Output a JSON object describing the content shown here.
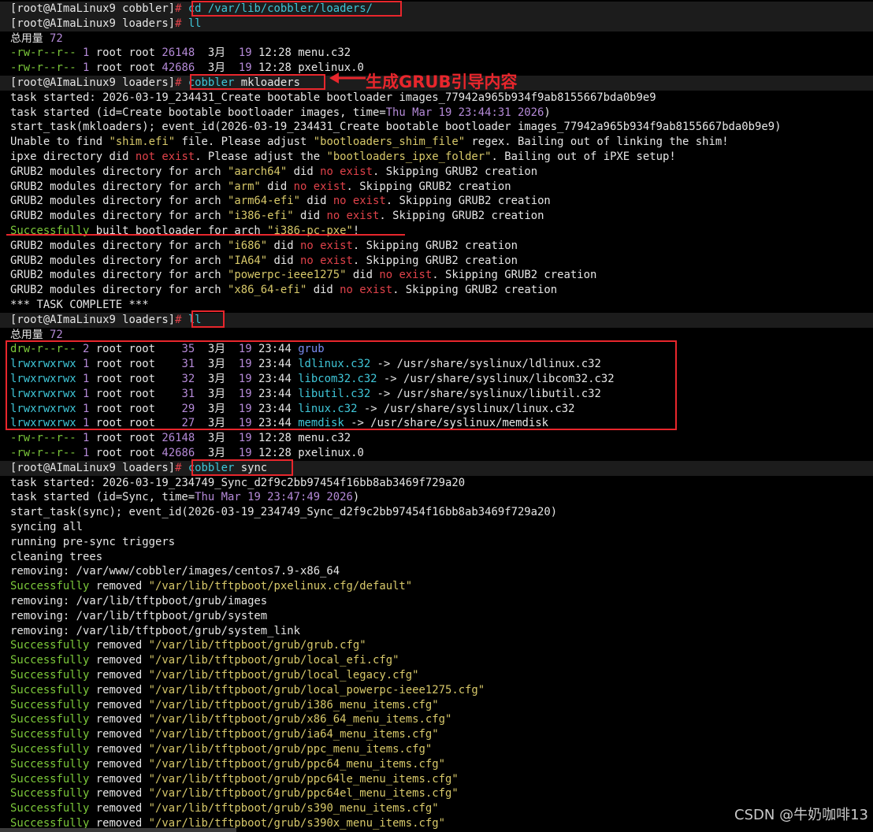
{
  "terminal": {
    "lines": [
      [
        {
          "t": "[root@AImaLinux9 cobbler]",
          "c": "w"
        },
        {
          "t": "# ",
          "c": "r"
        },
        {
          "t": "cd /var/lib/cobbler/loaders/",
          "c": "c"
        }
      ],
      [
        {
          "t": "[root@AImaLinux9 loaders]",
          "c": "w"
        },
        {
          "t": "# ",
          "c": "r"
        },
        {
          "t": "ll",
          "c": "c"
        }
      ],
      [
        {
          "t": "总用量 ",
          "c": "w"
        },
        {
          "t": "72",
          "c": "p"
        }
      ],
      [
        {
          "t": "-rw-r--r--",
          "c": "g"
        },
        {
          "t": " 1 ",
          "c": "p"
        },
        {
          "t": "root root ",
          "c": "w"
        },
        {
          "t": "26148",
          "c": "p"
        },
        {
          "t": "  3月  ",
          "c": "w"
        },
        {
          "t": "19",
          "c": "p"
        },
        {
          "t": " 12:28 menu.c32",
          "c": "w"
        }
      ],
      [
        {
          "t": "-rw-r--r--",
          "c": "g"
        },
        {
          "t": " 1 ",
          "c": "p"
        },
        {
          "t": "root root ",
          "c": "w"
        },
        {
          "t": "42686",
          "c": "p"
        },
        {
          "t": "  3月  ",
          "c": "w"
        },
        {
          "t": "19",
          "c": "p"
        },
        {
          "t": " 12:28 pxelinux.0",
          "c": "w"
        }
      ],
      [
        {
          "t": "[root@AImaLinux9 loaders]",
          "c": "w"
        },
        {
          "t": "# ",
          "c": "r"
        },
        {
          "t": "cobbler",
          "c": "c"
        },
        {
          "t": " mkloaders",
          "c": "w"
        }
      ],
      [
        {
          "t": "task started",
          "c": "w"
        },
        {
          "t": ": ",
          "c": "w"
        },
        {
          "t": "2026-03-19_234431_Create bootable bootloader images_77942a965b934f9ab8155667bda0b9e9",
          "c": "w"
        }
      ],
      [
        {
          "t": "task started (id=Create bootable bootloader images, time=",
          "c": "w"
        },
        {
          "t": "Thu Mar 19 23:44:31 2026",
          "c": "p"
        },
        {
          "t": ")",
          "c": "w"
        }
      ],
      [
        {
          "t": "start_task(mkloaders); event_id(2026-03-19_234431_Create bootable bootloader images_77942a965b934f9ab8155667bda0b9e9)",
          "c": "w"
        }
      ],
      [
        {
          "t": "Unable to find ",
          "c": "w"
        },
        {
          "t": "\"shim.efi\"",
          "c": "y"
        },
        {
          "t": " file. Please adjust ",
          "c": "w"
        },
        {
          "t": "\"bootloaders_shim_file\"",
          "c": "y"
        },
        {
          "t": " regex. Bailing out of linking the shim!",
          "c": "w"
        }
      ],
      [
        {
          "t": "ipxe directory did ",
          "c": "w"
        },
        {
          "t": "not exist",
          "c": "r"
        },
        {
          "t": ". Please adjust the ",
          "c": "w"
        },
        {
          "t": "\"bootloaders_ipxe_folder\"",
          "c": "y"
        },
        {
          "t": ". Bailing out of iPXE setup!",
          "c": "w"
        }
      ],
      [
        {
          "t": "GRUB2 modules directory for arch ",
          "c": "w"
        },
        {
          "t": "\"aarch64\"",
          "c": "y"
        },
        {
          "t": " did ",
          "c": "w"
        },
        {
          "t": "no exist",
          "c": "r"
        },
        {
          "t": ". Skipping GRUB2 creation",
          "c": "w"
        }
      ],
      [
        {
          "t": "GRUB2 modules directory for arch ",
          "c": "w"
        },
        {
          "t": "\"arm\"",
          "c": "y"
        },
        {
          "t": " did ",
          "c": "w"
        },
        {
          "t": "no exist",
          "c": "r"
        },
        {
          "t": ". Skipping GRUB2 creation",
          "c": "w"
        }
      ],
      [
        {
          "t": "GRUB2 modules directory for arch ",
          "c": "w"
        },
        {
          "t": "\"arm64-efi\"",
          "c": "y"
        },
        {
          "t": " did ",
          "c": "w"
        },
        {
          "t": "no exist",
          "c": "r"
        },
        {
          "t": ". Skipping GRUB2 creation",
          "c": "w"
        }
      ],
      [
        {
          "t": "GRUB2 modules directory for arch ",
          "c": "w"
        },
        {
          "t": "\"i386-efi\"",
          "c": "y"
        },
        {
          "t": " did ",
          "c": "w"
        },
        {
          "t": "no exist",
          "c": "r"
        },
        {
          "t": ". Skipping GRUB2 creation",
          "c": "w"
        }
      ],
      [
        {
          "t": "Successfully",
          "c": "g"
        },
        {
          "t": " built bootloader for arch ",
          "c": "w"
        },
        {
          "t": "\"i386-pc-pxe\"",
          "c": "y"
        },
        {
          "t": "!",
          "c": "w"
        }
      ],
      [
        {
          "t": "GRUB2 modules directory for arch ",
          "c": "w"
        },
        {
          "t": "\"i686\"",
          "c": "y"
        },
        {
          "t": " did ",
          "c": "w"
        },
        {
          "t": "no exist",
          "c": "r"
        },
        {
          "t": ". Skipping GRUB2 creation",
          "c": "w"
        }
      ],
      [
        {
          "t": "GRUB2 modules directory for arch ",
          "c": "w"
        },
        {
          "t": "\"IA64\"",
          "c": "y"
        },
        {
          "t": " did ",
          "c": "w"
        },
        {
          "t": "no exist",
          "c": "r"
        },
        {
          "t": ". Skipping GRUB2 creation",
          "c": "w"
        }
      ],
      [
        {
          "t": "GRUB2 modules directory for arch ",
          "c": "w"
        },
        {
          "t": "\"powerpc-ieee1275\"",
          "c": "y"
        },
        {
          "t": " did ",
          "c": "w"
        },
        {
          "t": "no exist",
          "c": "r"
        },
        {
          "t": ". Skipping GRUB2 creation",
          "c": "w"
        }
      ],
      [
        {
          "t": "GRUB2 modules directory for arch ",
          "c": "w"
        },
        {
          "t": "\"x86_64-efi\"",
          "c": "y"
        },
        {
          "t": " did ",
          "c": "w"
        },
        {
          "t": "no exist",
          "c": "r"
        },
        {
          "t": ". Skipping GRUB2 creation",
          "c": "w"
        }
      ],
      [
        {
          "t": "*** TASK COMPLETE ***",
          "c": "w"
        }
      ],
      [
        {
          "t": "[root@AImaLinux9 loaders]",
          "c": "w"
        },
        {
          "t": "# ",
          "c": "r"
        },
        {
          "t": "ll",
          "c": "c"
        }
      ],
      [
        {
          "t": "总用量 ",
          "c": "w"
        },
        {
          "t": "72",
          "c": "p"
        }
      ],
      [
        {
          "t": "drw-r--r--",
          "c": "g"
        },
        {
          "t": " 2 ",
          "c": "p"
        },
        {
          "t": "root root    ",
          "c": "w"
        },
        {
          "t": "35",
          "c": "p"
        },
        {
          "t": "  3月  ",
          "c": "w"
        },
        {
          "t": "19",
          "c": "p"
        },
        {
          "t": " 23:44 ",
          "c": "w"
        },
        {
          "t": "grub",
          "c": "b"
        }
      ],
      [
        {
          "t": "lrwxrwxrwx",
          "c": "c"
        },
        {
          "t": " 1 ",
          "c": "p"
        },
        {
          "t": "root root    ",
          "c": "w"
        },
        {
          "t": "31",
          "c": "p"
        },
        {
          "t": "  3月  ",
          "c": "w"
        },
        {
          "t": "19",
          "c": "p"
        },
        {
          "t": " 23:44 ",
          "c": "w"
        },
        {
          "t": "ldlinux.c32",
          "c": "c"
        },
        {
          "t": " -> /usr/share/syslinux/ldlinux.c32",
          "c": "w"
        }
      ],
      [
        {
          "t": "lrwxrwxrwx",
          "c": "c"
        },
        {
          "t": " 1 ",
          "c": "p"
        },
        {
          "t": "root root    ",
          "c": "w"
        },
        {
          "t": "32",
          "c": "p"
        },
        {
          "t": "  3月  ",
          "c": "w"
        },
        {
          "t": "19",
          "c": "p"
        },
        {
          "t": " 23:44 ",
          "c": "w"
        },
        {
          "t": "libcom32.c32",
          "c": "c"
        },
        {
          "t": " -> /usr/share/syslinux/libcom32.c32",
          "c": "w"
        }
      ],
      [
        {
          "t": "lrwxrwxrwx",
          "c": "c"
        },
        {
          "t": " 1 ",
          "c": "p"
        },
        {
          "t": "root root    ",
          "c": "w"
        },
        {
          "t": "31",
          "c": "p"
        },
        {
          "t": "  3月  ",
          "c": "w"
        },
        {
          "t": "19",
          "c": "p"
        },
        {
          "t": " 23:44 ",
          "c": "w"
        },
        {
          "t": "libutil.c32",
          "c": "c"
        },
        {
          "t": " -> /usr/share/syslinux/libutil.c32",
          "c": "w"
        }
      ],
      [
        {
          "t": "lrwxrwxrwx",
          "c": "c"
        },
        {
          "t": " 1 ",
          "c": "p"
        },
        {
          "t": "root root    ",
          "c": "w"
        },
        {
          "t": "29",
          "c": "p"
        },
        {
          "t": "  3月  ",
          "c": "w"
        },
        {
          "t": "19",
          "c": "p"
        },
        {
          "t": " 23:44 ",
          "c": "w"
        },
        {
          "t": "linux.c32",
          "c": "c"
        },
        {
          "t": " -> /usr/share/syslinux/linux.c32",
          "c": "w"
        }
      ],
      [
        {
          "t": "lrwxrwxrwx",
          "c": "c"
        },
        {
          "t": " 1 ",
          "c": "p"
        },
        {
          "t": "root root    ",
          "c": "w"
        },
        {
          "t": "27",
          "c": "p"
        },
        {
          "t": "  3月  ",
          "c": "w"
        },
        {
          "t": "19",
          "c": "p"
        },
        {
          "t": " 23:44 ",
          "c": "w"
        },
        {
          "t": "memdisk",
          "c": "c"
        },
        {
          "t": " -> /usr/share/syslinux/memdisk",
          "c": "w"
        }
      ],
      [
        {
          "t": "-rw-r--r--",
          "c": "g"
        },
        {
          "t": " 1 ",
          "c": "p"
        },
        {
          "t": "root root ",
          "c": "w"
        },
        {
          "t": "26148",
          "c": "p"
        },
        {
          "t": "  3月  ",
          "c": "w"
        },
        {
          "t": "19",
          "c": "p"
        },
        {
          "t": " 12:28 menu.c32",
          "c": "w"
        }
      ],
      [
        {
          "t": "-rw-r--r--",
          "c": "g"
        },
        {
          "t": " 1 ",
          "c": "p"
        },
        {
          "t": "root root ",
          "c": "w"
        },
        {
          "t": "42686",
          "c": "p"
        },
        {
          "t": "  3月  ",
          "c": "w"
        },
        {
          "t": "19",
          "c": "p"
        },
        {
          "t": " 12:28 pxelinux.0",
          "c": "w"
        }
      ],
      [
        {
          "t": "[root@AImaLinux9 loaders]",
          "c": "w"
        },
        {
          "t": "# ",
          "c": "r"
        },
        {
          "t": "cobbler",
          "c": "c"
        },
        {
          "t": " sync",
          "c": "w"
        }
      ],
      [
        {
          "t": "task started",
          "c": "w"
        },
        {
          "t": ": ",
          "c": "w"
        },
        {
          "t": "2026-03-19_234749_Sync_d2f9c2bb97454f16bb8ab3469f729a20",
          "c": "w"
        }
      ],
      [
        {
          "t": "task started (id=Sync, time=",
          "c": "w"
        },
        {
          "t": "Thu Mar 19 23:47:49 2026",
          "c": "p"
        },
        {
          "t": ")",
          "c": "w"
        }
      ],
      [
        {
          "t": "start_task(sync); event_id(2026-03-19_234749_Sync_d2f9c2bb97454f16bb8ab3469f729a20)",
          "c": "w"
        }
      ],
      [
        {
          "t": "syncing all",
          "c": "w"
        }
      ],
      [
        {
          "t": "running pre-sync triggers",
          "c": "w"
        }
      ],
      [
        {
          "t": "cleaning trees",
          "c": "w"
        }
      ],
      [
        {
          "t": "removing: /var/www/cobbler/images/centos7.9-x86_64",
          "c": "w"
        }
      ],
      [
        {
          "t": "Successfully",
          "c": "g"
        },
        {
          "t": " removed ",
          "c": "w"
        },
        {
          "t": "\"/var/lib/tftpboot/pxelinux.cfg/default\"",
          "c": "y"
        }
      ],
      [
        {
          "t": "removing: /var/lib/tftpboot/grub/images",
          "c": "w"
        }
      ],
      [
        {
          "t": "removing: /var/lib/tftpboot/grub/system",
          "c": "w"
        }
      ],
      [
        {
          "t": "removing: /var/lib/tftpboot/grub/system_link",
          "c": "w"
        }
      ],
      [
        {
          "t": "Successfully",
          "c": "g"
        },
        {
          "t": " removed ",
          "c": "w"
        },
        {
          "t": "\"/var/lib/tftpboot/grub/grub.cfg\"",
          "c": "y"
        }
      ],
      [
        {
          "t": "Successfully",
          "c": "g"
        },
        {
          "t": " removed ",
          "c": "w"
        },
        {
          "t": "\"/var/lib/tftpboot/grub/local_efi.cfg\"",
          "c": "y"
        }
      ],
      [
        {
          "t": "Successfully",
          "c": "g"
        },
        {
          "t": " removed ",
          "c": "w"
        },
        {
          "t": "\"/var/lib/tftpboot/grub/local_legacy.cfg\"",
          "c": "y"
        }
      ],
      [
        {
          "t": "Successfully",
          "c": "g"
        },
        {
          "t": " removed ",
          "c": "w"
        },
        {
          "t": "\"/var/lib/tftpboot/grub/local_powerpc-ieee1275.cfg\"",
          "c": "y"
        }
      ],
      [
        {
          "t": "Successfully",
          "c": "g"
        },
        {
          "t": " removed ",
          "c": "w"
        },
        {
          "t": "\"/var/lib/tftpboot/grub/i386_menu_items.cfg\"",
          "c": "y"
        }
      ],
      [
        {
          "t": "Successfully",
          "c": "g"
        },
        {
          "t": " removed ",
          "c": "w"
        },
        {
          "t": "\"/var/lib/tftpboot/grub/x86_64_menu_items.cfg\"",
          "c": "y"
        }
      ],
      [
        {
          "t": "Successfully",
          "c": "g"
        },
        {
          "t": " removed ",
          "c": "w"
        },
        {
          "t": "\"/var/lib/tftpboot/grub/ia64_menu_items.cfg\"",
          "c": "y"
        }
      ],
      [
        {
          "t": "Successfully",
          "c": "g"
        },
        {
          "t": " removed ",
          "c": "w"
        },
        {
          "t": "\"/var/lib/tftpboot/grub/ppc_menu_items.cfg\"",
          "c": "y"
        }
      ],
      [
        {
          "t": "Successfully",
          "c": "g"
        },
        {
          "t": " removed ",
          "c": "w"
        },
        {
          "t": "\"/var/lib/tftpboot/grub/ppc64_menu_items.cfg\"",
          "c": "y"
        }
      ],
      [
        {
          "t": "Successfully",
          "c": "g"
        },
        {
          "t": " removed ",
          "c": "w"
        },
        {
          "t": "\"/var/lib/tftpboot/grub/ppc64le_menu_items.cfg\"",
          "c": "y"
        }
      ],
      [
        {
          "t": "Successfully",
          "c": "g"
        },
        {
          "t": " removed ",
          "c": "w"
        },
        {
          "t": "\"/var/lib/tftpboot/grub/ppc64el_menu_items.cfg\"",
          "c": "y"
        }
      ],
      [
        {
          "t": "Successfully",
          "c": "g"
        },
        {
          "t": " removed ",
          "c": "w"
        },
        {
          "t": "\"/var/lib/tftpboot/grub/s390_menu_items.cfg\"",
          "c": "y"
        }
      ],
      [
        {
          "t": "Successfully",
          "c": "g"
        },
        {
          "t": " removed ",
          "c": "w"
        },
        {
          "t": "\"/var/lib/tftpboot/grub/s390x_menu_items.cfg\"",
          "c": "y"
        }
      ]
    ],
    "prompt_line_indexes": [
      0,
      1,
      5,
      21,
      31
    ]
  },
  "annotation": {
    "label": "生成GRUB引导内容",
    "color": "#e8262c"
  },
  "watermark": "CSDN @牛奶咖啡13",
  "colors": {
    "background": "#000000",
    "text": "#e6e6e6",
    "green": "#7cc93a",
    "red": "#e0424a",
    "yellow": "#d8c96a",
    "cyan": "#3fc6d8",
    "purple": "#b58ad8",
    "blue": "#7b8cf0",
    "annotation_red": "#e8262c"
  }
}
